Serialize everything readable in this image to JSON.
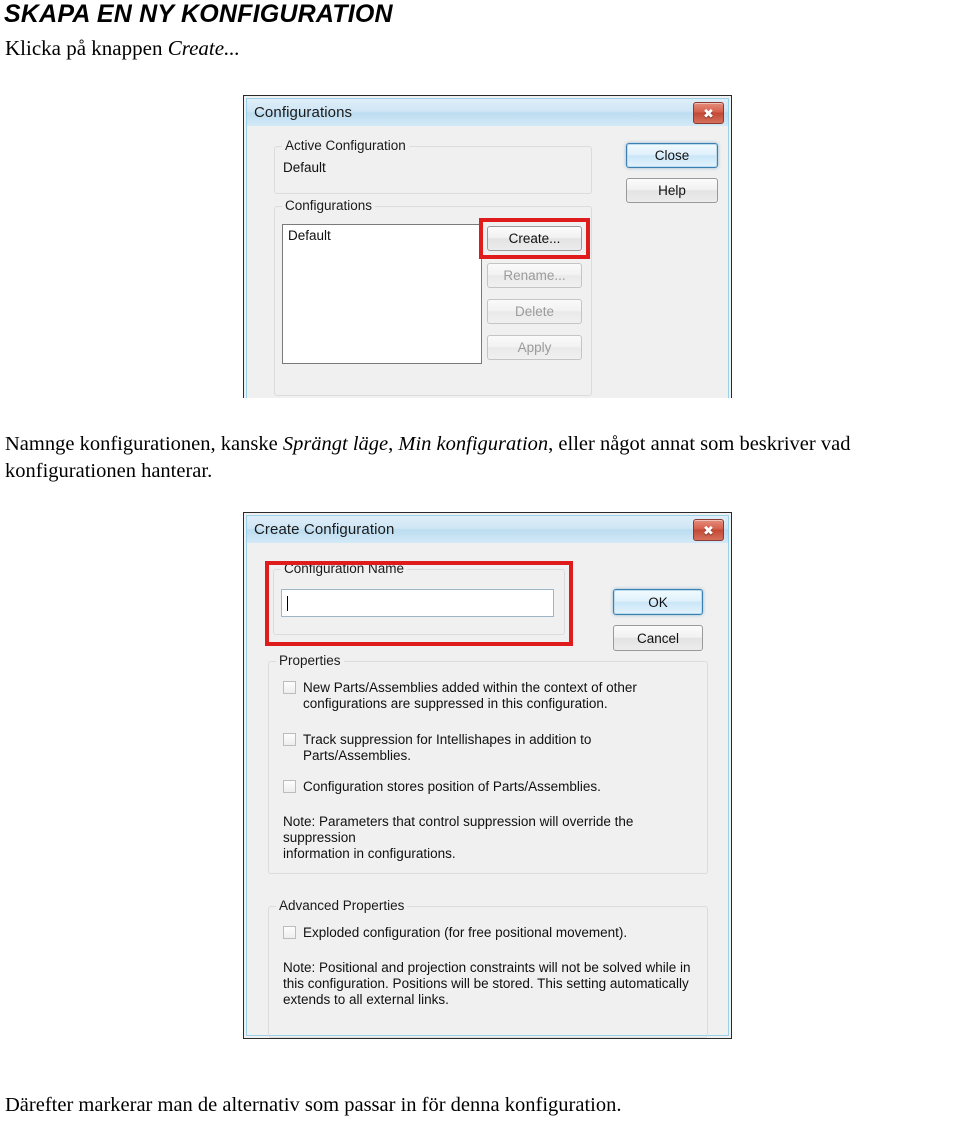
{
  "document": {
    "title": "SKAPA EN NY KONFIGURATION",
    "subtitle_prefix": "Klicka på knappen ",
    "subtitle_emphasis": "Create...",
    "paragraph_part1": "Namnge konfigurationen, kanske ",
    "paragraph_em1": "Sprängt läge",
    "paragraph_part2": ", ",
    "paragraph_em2": "Min konfiguration",
    "paragraph_part3": ", eller något annat som beskriver vad konfigurationen hanterar.",
    "footer": "Därefter markerar man de alternativ som passar in för denna konfiguration."
  },
  "dialog_configurations": {
    "title": "Configurations",
    "close_icon": "close-icon",
    "active_configuration": {
      "group_label": "Active Configuration",
      "value": "Default"
    },
    "configurations": {
      "group_label": "Configurations",
      "list_items": [
        "Default"
      ]
    },
    "buttons": {
      "close": "Close",
      "help": "Help",
      "create": "Create...",
      "rename": "Rename...",
      "delete": "Delete",
      "apply": "Apply"
    },
    "highlight": "create-button-highlight"
  },
  "dialog_create_configuration": {
    "title": "Create Configuration",
    "close_icon": "close-icon",
    "configuration_name": {
      "group_label": "Configuration Name",
      "value": "",
      "placeholder": ""
    },
    "buttons": {
      "ok": "OK",
      "cancel": "Cancel"
    },
    "properties": {
      "group_label": "Properties",
      "checkboxes": [
        {
          "checked": false,
          "label_line1": "New Parts/Assemblies added within the context of other",
          "label_line2": "configurations are suppressed in this configuration."
        },
        {
          "checked": false,
          "label_line1": "Track suppression for Intellishapes in addition to Parts/Assemblies.",
          "label_line2": ""
        },
        {
          "checked": false,
          "label_line1": "Configuration stores position of Parts/Assemblies.",
          "label_line2": ""
        }
      ],
      "note_line1": "Note: Parameters that control suppression will override the suppression",
      "note_line2": "information in configurations."
    },
    "advanced_properties": {
      "group_label": "Advanced Properties",
      "checkboxes": [
        {
          "checked": false,
          "label_line1": "Exploded configuration (for free positional movement).",
          "label_line2": ""
        }
      ],
      "note_line1": "Note: Positional and projection constraints will not be solved while in",
      "note_line2": "this configuration. Positions will be stored.  This setting automatically",
      "note_line3": "extends to all external links."
    },
    "highlight": "configuration-name-highlight"
  },
  "colors": {
    "annotation_red": "#e01b1b",
    "titlebar_blue": "#bcdcf0",
    "close_button_red": "#c24934",
    "default_button_border": "#3c7fb1"
  }
}
